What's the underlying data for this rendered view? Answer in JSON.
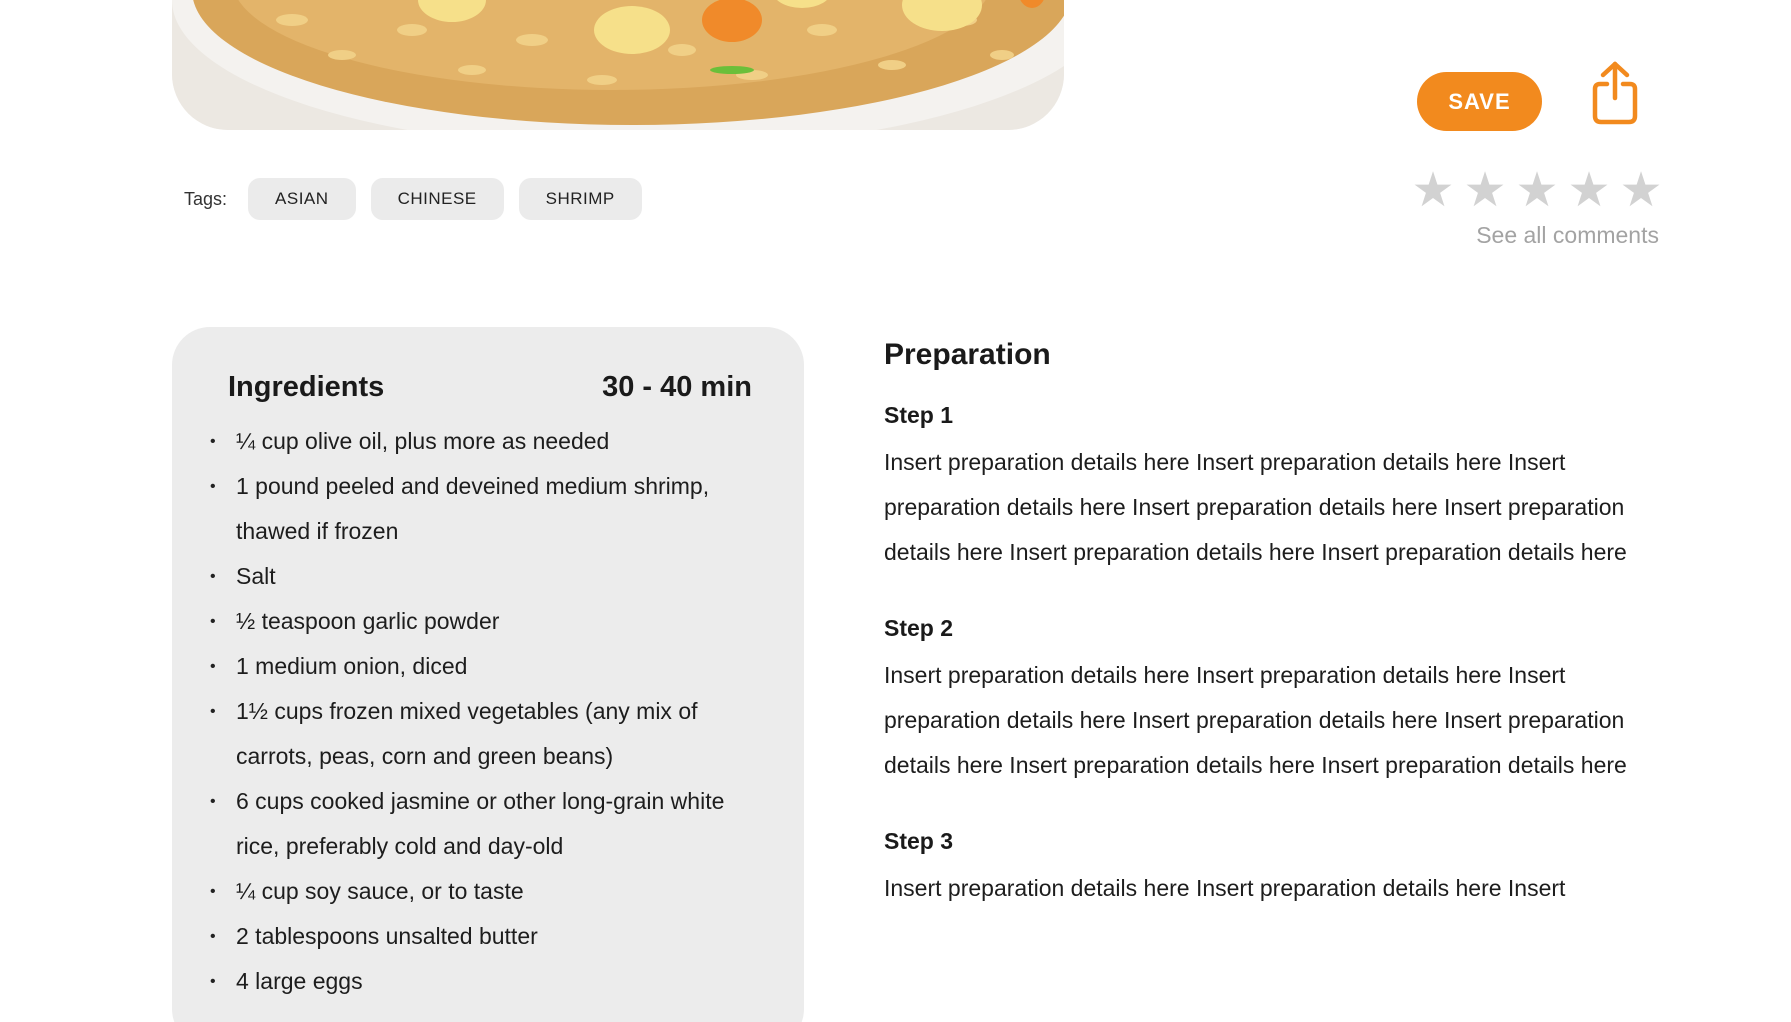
{
  "hero": {
    "image_alt": "shrimp fried rice"
  },
  "tags": {
    "label": "Tags:",
    "items": [
      "ASIAN",
      "CHINESE",
      "SHRIMP"
    ]
  },
  "actions": {
    "save_label": "SAVE",
    "share_icon": "share-icon",
    "rating": {
      "value": 0,
      "max": 5
    },
    "see_comments": "See all comments",
    "colors": {
      "accent": "#f28a1e",
      "star_empty": "#d2d2d2"
    }
  },
  "ingredients": {
    "title": "Ingredients",
    "time": "30 - 40 min",
    "items": [
      "¼ cup olive oil, plus more as needed",
      "1 pound peeled and deveined medium shrimp, thawed if frozen",
      "Salt",
      "½ teaspoon garlic powder",
      "1 medium onion, diced",
      "1½ cups frozen mixed vegetables (any mix of carrots, peas, corn and green beans)",
      "6 cups cooked jasmine or other long-grain white rice, preferably cold and day-old",
      "¼ cup soy sauce, or to taste",
      "2 tablespoons unsalted butter",
      "4 large eggs"
    ]
  },
  "preparation": {
    "title": "Preparation",
    "steps": [
      {
        "title": "Step 1",
        "text": "Insert preparation details here Insert preparation details here Insert preparation details here Insert preparation details here Insert preparation details here Insert preparation details here Insert preparation details here"
      },
      {
        "title": "Step 2",
        "text": "Insert preparation details here Insert preparation details here Insert preparation details here Insert preparation details here Insert preparation details here Insert preparation details here Insert preparation details here"
      },
      {
        "title": "Step 3",
        "text": "Insert preparation details here Insert preparation details here Insert"
      }
    ]
  }
}
